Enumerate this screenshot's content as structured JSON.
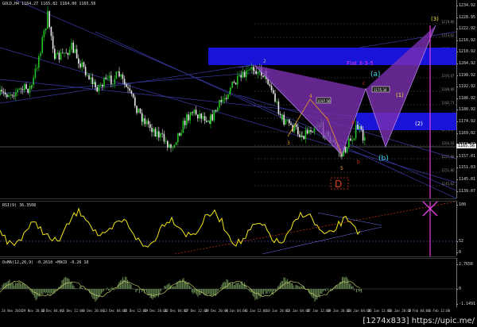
{
  "symbol_header": "GOLD,H4  1164.27 1165.82 1164.00 1165.56",
  "pattern": {
    "name": "Flat 3-3-5",
    "point_d": "D",
    "labels": {
      "wave_a": "(a)",
      "wave_b": "(b)",
      "wave_c": "c",
      "wave_b_small": "b",
      "wave_a_small": "a",
      "w1": "(1)",
      "w2": "(2)",
      "w3": "(3)",
      "n2": "2",
      "n3": "3",
      "n4": "4",
      "n5": "5",
      "n1": "1"
    },
    "small_boxes": [
      "1197.56",
      "1175.34"
    ]
  },
  "price_axis": [
    "1234.92",
    "1228.95",
    "1222.92",
    "1216.92",
    "1210.92",
    "1204.92",
    "1198.92",
    "1192.92",
    "1186.92",
    "1180.92",
    "1174.92",
    "1169.02",
    "1163.02",
    "1157.01",
    "1151.03",
    "1145.01",
    "1139.07"
  ],
  "current_price": "1165.56",
  "fib_levels": [
    "1219.80",
    "1213.62",
    "1207.44",
    "1201.26",
    "1195.07",
    "1188.89",
    "1182.71",
    "1176.53",
    "1170.34",
    "1164.16",
    "1157.98",
    "1151.80",
    "1145.62"
  ],
  "rsi": {
    "label": "RSI(9) 36.3508",
    "axis": [
      "100",
      "52",
      "0"
    ]
  },
  "osma": {
    "label": "OsMA(12,26,9) -0.2610  •MACD -0.26 10",
    "axis": [
      "2.7656",
      "0",
      "-1.1491"
    ]
  },
  "time_axis": [
    "24 Nov 2016",
    "29 Nov 20:00",
    "2 Dec 04:00",
    "6 Dec 12:00",
    "8 Dec 20:00",
    "13 Dec 04:00",
    "15 Dec 12:00",
    "19 Dec 20:00",
    "22 Dec 04:00",
    "27 Dec 12:00",
    "29 Dec 20:00",
    "4 Jan 04:00",
    "6 Jan 12:00",
    "10 Jan 20:00",
    "13 Jan 04:00",
    "17 Jan 12:00",
    "19 Jan 20:00",
    "24 Jan 04:00",
    "26 Jan 12:00",
    "30 Jan 20:00",
    "2 Feb 04:00",
    "6 Feb 12:00"
  ],
  "watermark": "[1274x833] https://upic.me/",
  "colors": {
    "bull": "#22c422",
    "bear": "#e8e8e8",
    "pattern_fill": "#7b2fb0",
    "blue_zone": "#1a14d8",
    "rsi_line": "#f2e61a",
    "osma_fill": "#5c7a4a",
    "magenta": "#e040e0",
    "yellow": "#e8e43a",
    "cyan": "#3fd8e8",
    "red": "#e23a1a"
  }
}
